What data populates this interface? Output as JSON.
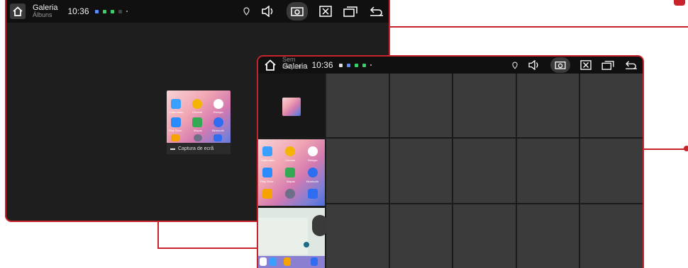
{
  "colors": {
    "accent": "#c8222a",
    "screen_bg": "#1e1e1e",
    "cell": "#3b3b3b"
  },
  "back_screen": {
    "title": "Galeria",
    "subtitle": "Álbuns",
    "time": "10:36",
    "album_label": "Captura de ecrã",
    "apps": [
      "Calendário",
      "Chrome",
      "Relógio",
      "Play Store",
      "Mapas",
      "Bluetooth"
    ]
  },
  "front_screen": {
    "title": "Galeria",
    "subtitle_overlay": "Sem etiqueta",
    "time": "10:36",
    "apps": [
      "Calendário",
      "Chrome",
      "Relógio",
      "Play Store",
      "Mapas",
      "Bluetooth"
    ]
  },
  "icons": [
    "home-icon",
    "location-icon",
    "volume-icon",
    "screenshot-icon",
    "close-icon",
    "recents-icon",
    "back-icon"
  ]
}
